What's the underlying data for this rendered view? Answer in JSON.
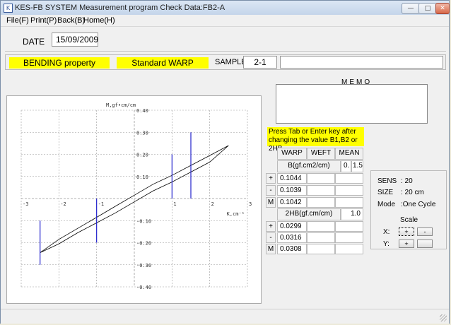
{
  "window": {
    "title": "KES-FB SYSTEM Measurement program Check Data:FB2-A",
    "icon": "app-icon"
  },
  "menu": [
    "File(F)",
    "Print(P)",
    "Back(B)",
    "Home(H)"
  ],
  "date": {
    "label": "DATE",
    "value": "15/09/2009"
  },
  "header": {
    "property": "BENDING property",
    "standard": "Standard  WARP",
    "sample_label": "SAMPLE",
    "sample_value": "2-1",
    "sample_extra": ""
  },
  "memo": {
    "label": "MEMO",
    "value": ""
  },
  "instructions": "Press Tab or Enter key after changing the value B1,B2 or 2HB",
  "table": {
    "columns": [
      "WARP",
      "WEFT",
      "MEAN"
    ],
    "b_label": "B(gf.cm2/cm)",
    "b_param": "0.",
    "b_param2": "1.5",
    "b_rows": [
      {
        "sign": "+",
        "warp": "0.1044",
        "weft": "",
        "mean": ""
      },
      {
        "sign": "-",
        "warp": "0.1039",
        "weft": "",
        "mean": ""
      },
      {
        "sign": "M",
        "warp": "0.1042",
        "weft": "",
        "mean": ""
      }
    ],
    "hb_label": "2HB(gf.cm/cm)",
    "hb_param": "1.0",
    "hb_rows": [
      {
        "sign": "+",
        "warp": "0.0299",
        "weft": "",
        "mean": ""
      },
      {
        "sign": "-",
        "warp": "0.0316",
        "weft": "",
        "mean": ""
      },
      {
        "sign": "M",
        "warp": "0.0308",
        "weft": "",
        "mean": ""
      }
    ]
  },
  "info": {
    "sens_label": "SENS",
    "sens_value": ": 20",
    "size_label": "SIZE",
    "size_value": ": 20 cm",
    "mode_label": "Mode",
    "mode_value": ":One Cycle",
    "scale_label": "Scale",
    "x_label": "X:",
    "x_plus": "+",
    "x_minus": "-",
    "y_label": "Y:",
    "y_plus": "+",
    "y_minus": ""
  },
  "chart_data": {
    "type": "line",
    "title": "",
    "xlabel": "K,cm⁻¹",
    "ylabel": "M,gf•cm/cm",
    "xlim": [
      -3,
      3
    ],
    "ylim": [
      -0.4,
      0.4
    ],
    "x_ticks": [
      -3,
      -2,
      -1,
      1,
      2,
      3
    ],
    "x_tick_labels": [
      "-3",
      "-2",
      "-1",
      "1",
      "2",
      "3"
    ],
    "y_ticks": [
      0.4,
      0.3,
      0.2,
      0.1,
      -0.1,
      -0.2,
      -0.3,
      -0.4
    ],
    "y_tick_labels": [
      "0.40",
      "0.30",
      "0.20",
      "0.10",
      "-0.10",
      "-0.20",
      "-0.30",
      "-0.40"
    ],
    "grid": true,
    "series": [
      {
        "values_upper": [
          [
            -2.5,
            -0.245
          ],
          [
            -2.0,
            -0.185
          ],
          [
            -1.5,
            -0.135
          ],
          [
            -1.0,
            -0.085
          ],
          [
            -0.5,
            -0.035
          ],
          [
            0.0,
            0.015
          ],
          [
            0.5,
            0.065
          ],
          [
            1.0,
            0.105
          ],
          [
            1.5,
            0.15
          ],
          [
            2.0,
            0.195
          ],
          [
            2.5,
            0.24
          ]
        ],
        "values_lower": [
          [
            2.5,
            0.24
          ],
          [
            2.0,
            0.165
          ],
          [
            1.5,
            0.12
          ],
          [
            1.0,
            0.075
          ],
          [
            0.5,
            0.035
          ],
          [
            0.0,
            -0.015
          ],
          [
            -0.5,
            -0.065
          ],
          [
            -1.0,
            -0.11
          ],
          [
            -1.5,
            -0.155
          ],
          [
            -2.0,
            -0.205
          ],
          [
            -2.5,
            -0.245
          ]
        ]
      }
    ],
    "markers": [
      {
        "x": -2.5,
        "y1": -0.3,
        "y2": -0.1
      },
      {
        "x": -1.0,
        "y1": -0.2,
        "y2": 0.0
      },
      {
        "x": 1.0,
        "y1": 0.0,
        "y2": 0.2
      },
      {
        "x": 1.5,
        "y1": 0.0,
        "y2": 0.3
      }
    ]
  },
  "colors": {
    "highlight": "#ffff00",
    "marker": "#2222cc",
    "curve": "#000000",
    "grid": "#999999"
  }
}
